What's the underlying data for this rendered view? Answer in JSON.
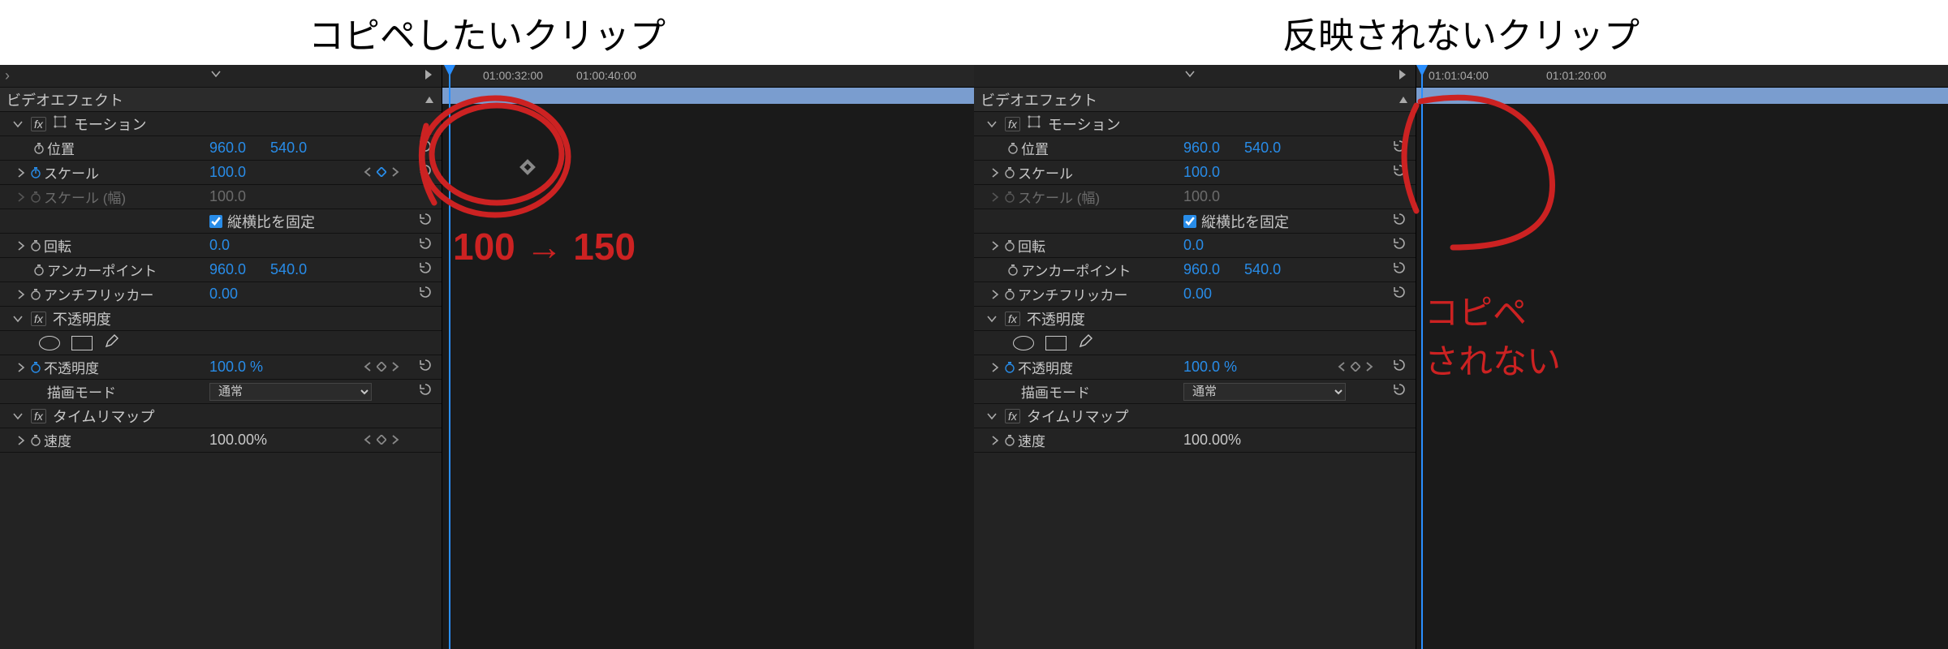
{
  "titles": {
    "left": "コピペしたいクリップ",
    "right": "反映されないクリップ"
  },
  "panel_section": "ビデオエフェクト",
  "groups": {
    "motion": "モーション",
    "opacity": "不透明度",
    "time_remap": "タイムリマップ"
  },
  "props": {
    "position": {
      "label": "位置",
      "x": "960.0",
      "y": "540.0"
    },
    "scale": {
      "label": "スケール",
      "v": "100.0"
    },
    "scale_w": {
      "label": "スケール (幅)",
      "v": "100.0"
    },
    "lock_aspect": "縦横比を固定",
    "rotation": {
      "label": "回転",
      "v": "0.0"
    },
    "anchor": {
      "label": "アンカーポイント",
      "x": "960.0",
      "y": "540.0"
    },
    "antiflicker": {
      "label": "アンチフリッカー",
      "v": "0.00"
    },
    "opacity": {
      "label": "不透明度",
      "v": "100.0 %"
    },
    "blend": {
      "label": "描画モード",
      "v": "通常"
    },
    "speed": {
      "label": "速度",
      "v": "100.00%"
    }
  },
  "left_ruler": {
    "t1": "01:00:32:00",
    "t2": "01:00:40:00"
  },
  "right_ruler": {
    "t1": "01:01:04:00",
    "t2": "01:01:20:00"
  },
  "annotations": {
    "left_text": "100 → 150",
    "right_text1": "コピペ",
    "right_text2": "されない"
  }
}
